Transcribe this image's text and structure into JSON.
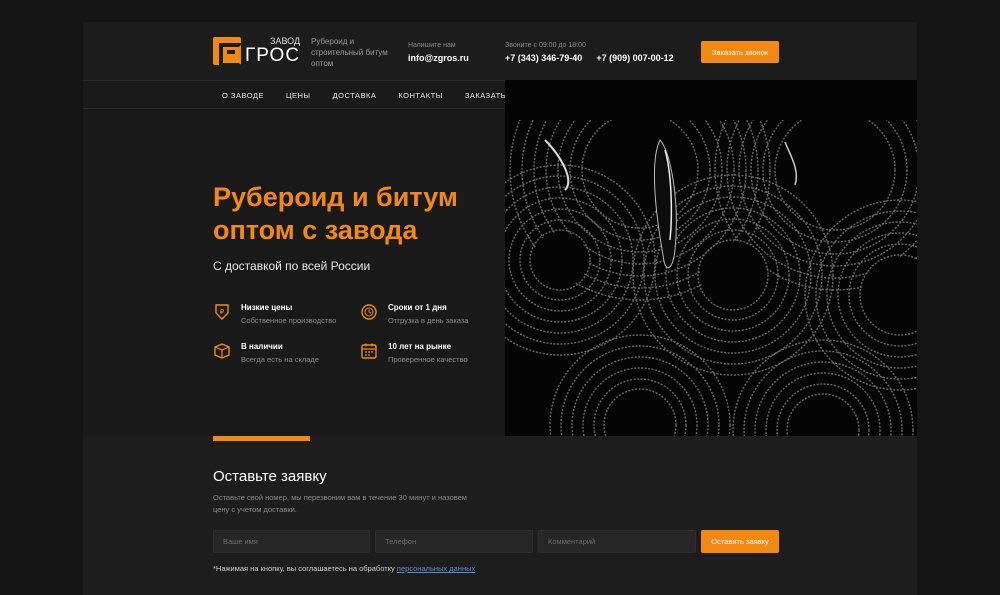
{
  "header": {
    "logo_small": "ЗАВОД",
    "logo_main": "ГРОС",
    "tagline": "Рубероид и строительный битум оптом",
    "mail_label": "Напишите нам",
    "email": "info@zgros.ru",
    "phones_label": "Звоните с 09:00 до 18:00",
    "phone1": "+7 (343) 346-79-40",
    "phone2": "+7 (909) 007-00-12",
    "call_button": "Заказать звонок"
  },
  "nav": {
    "items": [
      {
        "label": "О ЗАВОДЕ"
      },
      {
        "label": "ЦЕНЫ"
      },
      {
        "label": "ДОСТАВКА"
      },
      {
        "label": "КОНТАКТЫ"
      },
      {
        "label": "ЗАКАЗАТЬ"
      }
    ]
  },
  "hero": {
    "title": "Рубероид и битум оптом с завода",
    "subtitle": "С доставкой по всей России",
    "features": [
      {
        "title": "Низкие цены",
        "sub": "Собственное производство",
        "icon": "price-tag-icon"
      },
      {
        "title": "Сроки от 1 дня",
        "sub": "Отгрузка в день заказа",
        "icon": "clock-icon"
      },
      {
        "title": "В наличии",
        "sub": "Всегда есть на складе",
        "icon": "box-icon"
      },
      {
        "title": "10 лет на рынке",
        "sub": "Проверенное качество",
        "icon": "calendar-icon"
      }
    ]
  },
  "form": {
    "title": "Оставьте заявку",
    "desc": "Оставьте свой номер, мы перезвоним вам в течение 30 минут и назовем цену с учетом доставки.",
    "name_placeholder": "Ваше имя",
    "phone_placeholder": "Телефон",
    "comment_placeholder": "Комментарий",
    "submit": "Оставить заявку",
    "consent": "*Нажимая на кнопку, вы соглашаетесь на обработку",
    "consent_link": "персональных данных"
  },
  "colors": {
    "accent": "#f28a12",
    "background": "#1b1b1b",
    "link": "#5b8ad6"
  }
}
